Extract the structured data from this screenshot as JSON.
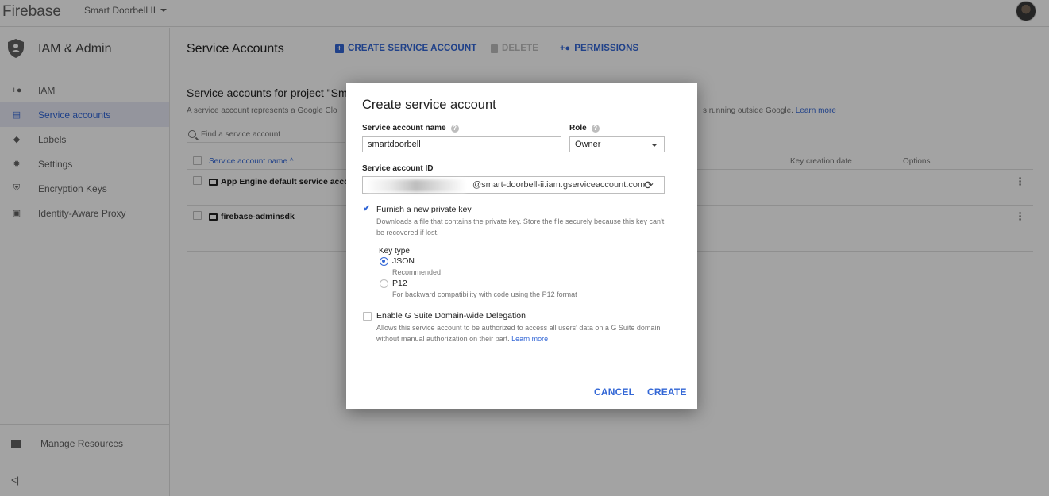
{
  "topbar": {
    "brand": "Firebase",
    "project": "Smart Doorbell II"
  },
  "sidebar": {
    "title": "IAM & Admin",
    "items": [
      {
        "label": "IAM",
        "icon": "person-add-icon"
      },
      {
        "label": "Service accounts",
        "icon": "service-account-icon",
        "active": true
      },
      {
        "label": "Labels",
        "icon": "label-icon"
      },
      {
        "label": "Settings",
        "icon": "gear-icon"
      },
      {
        "label": "Encryption Keys",
        "icon": "shield-key-icon"
      },
      {
        "label": "Identity-Aware Proxy",
        "icon": "proxy-icon"
      }
    ],
    "manage_resources": "Manage Resources",
    "collapse": "<|"
  },
  "main": {
    "title": "Service Accounts",
    "buttons": {
      "create": "CREATE SERVICE ACCOUNT",
      "delete": "DELETE",
      "permissions": "PERMISSIONS"
    },
    "section_title": "Service accounts for project \"Sm",
    "section_desc": "A service account represents a Google Clo",
    "section_desc_right": "s running outside Google.",
    "learn_more": "Learn more",
    "search_placeholder": "Find a service account",
    "table": {
      "headers": {
        "name": "Service account name ^",
        "key_date": "Key creation date",
        "options": "Options"
      },
      "rows": [
        {
          "name": "App Engine default service accou"
        },
        {
          "name": "firebase-adminsdk"
        }
      ]
    }
  },
  "dialog": {
    "title": "Create service account",
    "name_label": "Service account name",
    "name_value": "smartdoorbell",
    "role_label": "Role",
    "role_value": "Owner",
    "id_label": "Service account ID",
    "id_suffix": "@smart-doorbell-ii.iam.gserviceaccount.com",
    "furnish_label": "Furnish a new private key",
    "furnish_checked": true,
    "furnish_desc": "Downloads a file that contains the private key. Store the file securely because this key can't be recovered if lost.",
    "key_type_label": "Key type",
    "key_types": [
      {
        "label": "JSON",
        "desc": "Recommended",
        "selected": true
      },
      {
        "label": "P12",
        "desc": "For backward compatibility with code using the P12 format",
        "selected": false
      }
    ],
    "gsuite_label": "Enable G Suite Domain-wide Delegation",
    "gsuite_checked": false,
    "gsuite_desc": "Allows this service account to be authorized to access all users' data on a G Suite domain without manual authorization on their part.",
    "gsuite_learn_more": "Learn more",
    "cancel": "CANCEL",
    "create": "CREATE"
  },
  "colors": {
    "accent": "#3367d6",
    "active_bg": "#e8eaf6",
    "overlay": "rgba(0,0,0,0.36)"
  }
}
